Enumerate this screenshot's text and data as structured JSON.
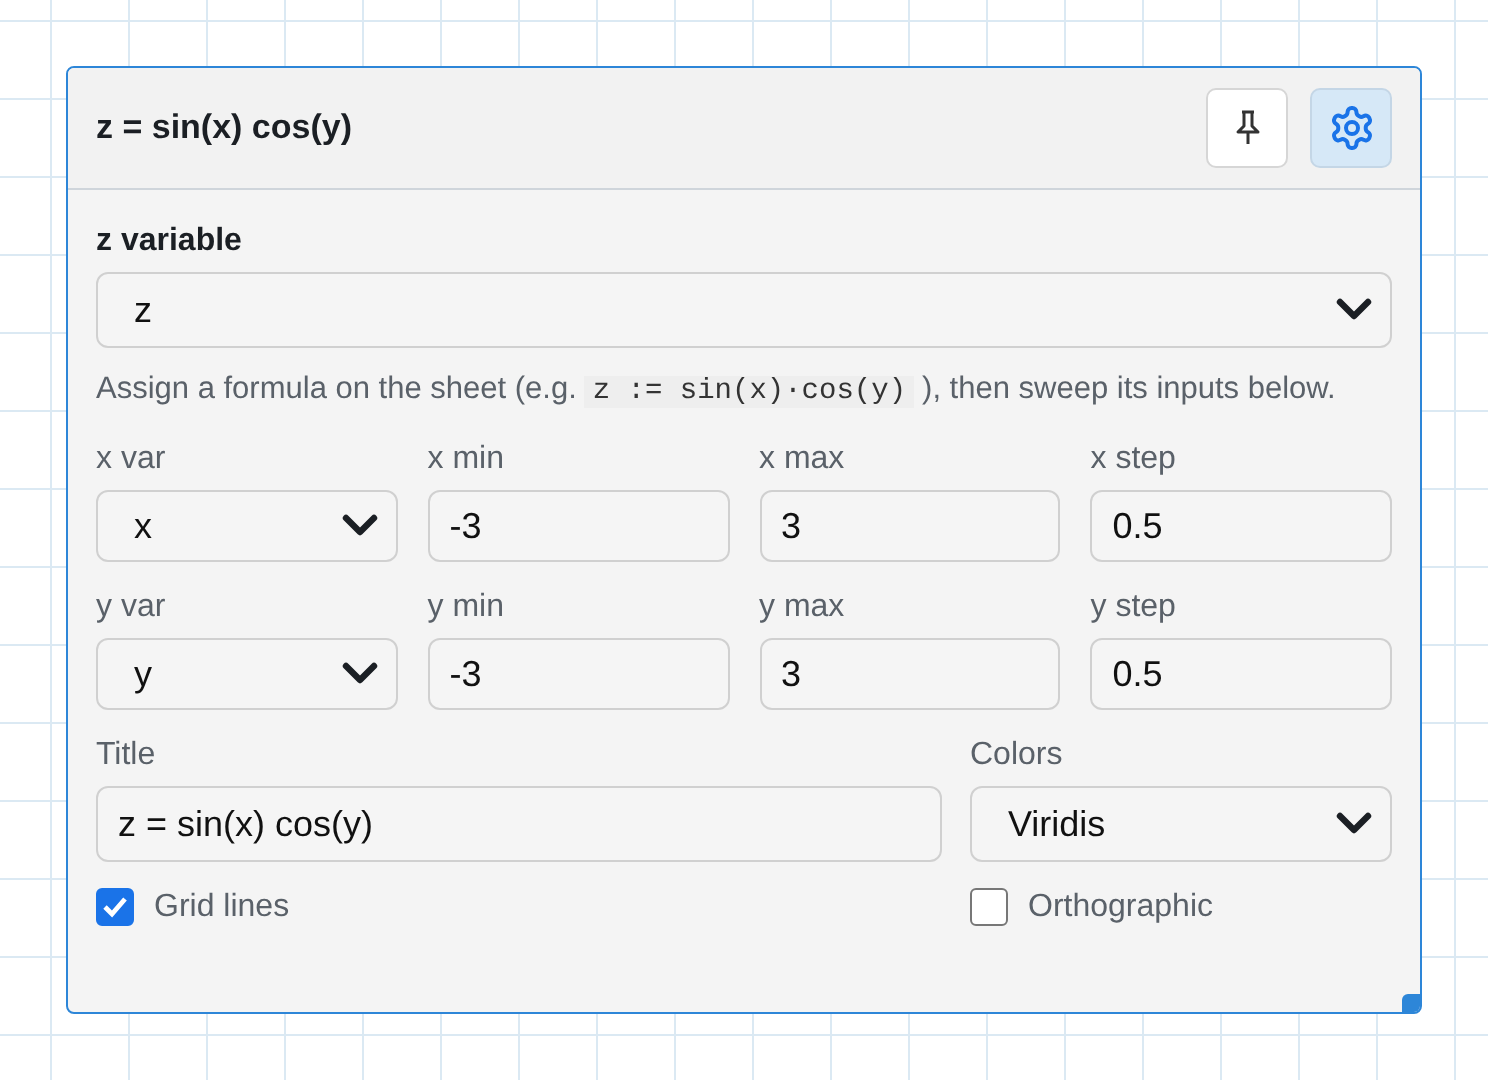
{
  "panel": {
    "title": "z = sin(x) cos(y)",
    "header_buttons": [
      {
        "kind": "pin",
        "selected": false
      },
      {
        "kind": "settings",
        "selected": true
      }
    ],
    "z_variable": {
      "label": "z variable",
      "value": "z"
    },
    "hint": {
      "before": "Assign a formula on the sheet (e.g.",
      "code": "z := sin(x)·cos(y)",
      "after": "), then sweep its inputs below."
    },
    "ranges": [
      [
        {
          "kind": "select",
          "label": "x var",
          "value": "x"
        },
        {
          "kind": "input",
          "label": "x min",
          "value": "-3"
        },
        {
          "kind": "input",
          "label": "x max",
          "value": "3"
        },
        {
          "kind": "input",
          "label": "x step",
          "value": "0.5"
        }
      ],
      [
        {
          "kind": "select",
          "label": "y var",
          "value": "y"
        },
        {
          "kind": "input",
          "label": "y min",
          "value": "-3"
        },
        {
          "kind": "input",
          "label": "y max",
          "value": "3"
        },
        {
          "kind": "input",
          "label": "y step",
          "value": "0.5"
        }
      ]
    ],
    "title_field": {
      "label": "Title",
      "value": "z = sin(x) cos(y)"
    },
    "colors": {
      "label": "Colors",
      "value": "Viridis"
    },
    "options": [
      {
        "label": "Grid lines",
        "checked": true
      },
      {
        "label": "Orthographic",
        "checked": false
      }
    ]
  }
}
